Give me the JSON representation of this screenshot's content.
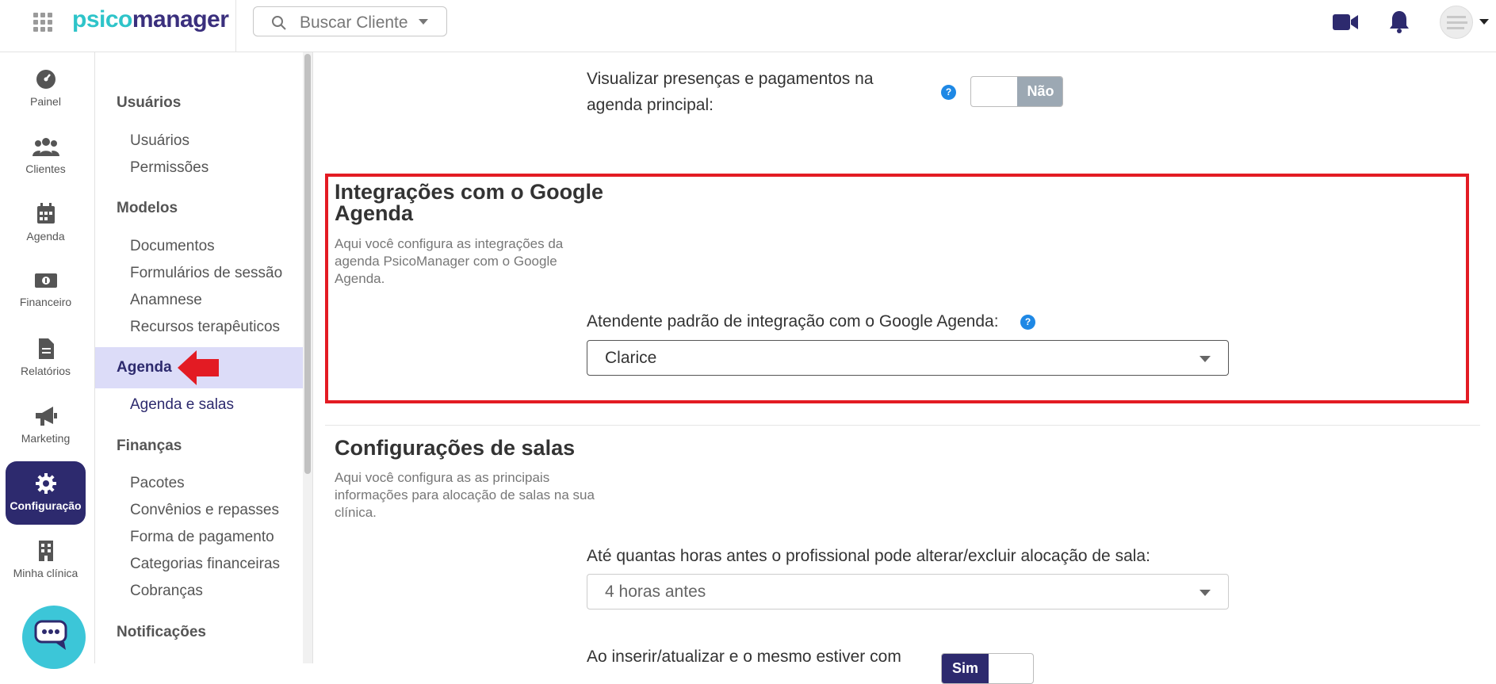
{
  "brand": {
    "part1": "psico",
    "part2": "manager"
  },
  "search": {
    "placeholder": "Buscar Cliente"
  },
  "rail": [
    {
      "label": "Painel",
      "icon": "dashboard-icon"
    },
    {
      "label": "Clientes",
      "icon": "users-icon"
    },
    {
      "label": "Agenda",
      "icon": "calendar-icon"
    },
    {
      "label": "Financeiro",
      "icon": "money-icon"
    },
    {
      "label": "Relatórios",
      "icon": "document-icon"
    },
    {
      "label": "Marketing",
      "icon": "megaphone-icon"
    },
    {
      "label": "Configuração",
      "icon": "gear-icon",
      "active": true
    },
    {
      "label": "Minha clínica",
      "icon": "building-icon"
    }
  ],
  "menu": {
    "usuarios_head": "Usuários",
    "usuarios": "Usuários",
    "permissoes": "Permissões",
    "modelos_head": "Modelos",
    "documentos": "Documentos",
    "formularios": "Formulários de sessão",
    "anamnese": "Anamnese",
    "recursos": "Recursos terapêuticos",
    "agenda_head": "Agenda",
    "agenda_salas": "Agenda e salas",
    "financas_head": "Finanças",
    "pacotes": "Pacotes",
    "convenios": "Convênios e repasses",
    "forma_pagamento": "Forma de pagamento",
    "categorias": "Categorias financeiras",
    "cobrancas": "Cobranças",
    "notificacoes_head": "Notificações"
  },
  "presencas": {
    "label_line1": "Visualizar presenças e pagamentos na",
    "label_line2": "agenda principal:",
    "help": "?",
    "toggle_value": "Não"
  },
  "google": {
    "title_line1": "Integrações com o Google",
    "title_line2": "Agenda",
    "desc_line1": "Aqui você configura as integrações da",
    "desc_line2": "agenda PsicoManager com o Google",
    "desc_line3": "Agenda.",
    "field_label": "Atendente padrão de integração com o Google Agenda:",
    "help": "?",
    "selected": "Clarice"
  },
  "salas": {
    "title": "Configurações de salas",
    "desc_line1": "Aqui você configura as as principais",
    "desc_line2": "informações para alocação de salas na sua",
    "desc_line3": "clínica.",
    "hours_label": "Até quantas horas antes o profissional pode alterar/excluir alocação de sala:",
    "hours_selected": "4 horas antes",
    "insert_label": "Ao inserir/atualizar e o mesmo estiver com",
    "insert_toggle": "Sim"
  },
  "colors": {
    "brand_teal": "#2ec4c9",
    "brand_navy": "#3a2f7d",
    "active_nav": "#2d2a6e",
    "highlight_red": "#e31b23",
    "help_blue": "#1e88e5"
  }
}
